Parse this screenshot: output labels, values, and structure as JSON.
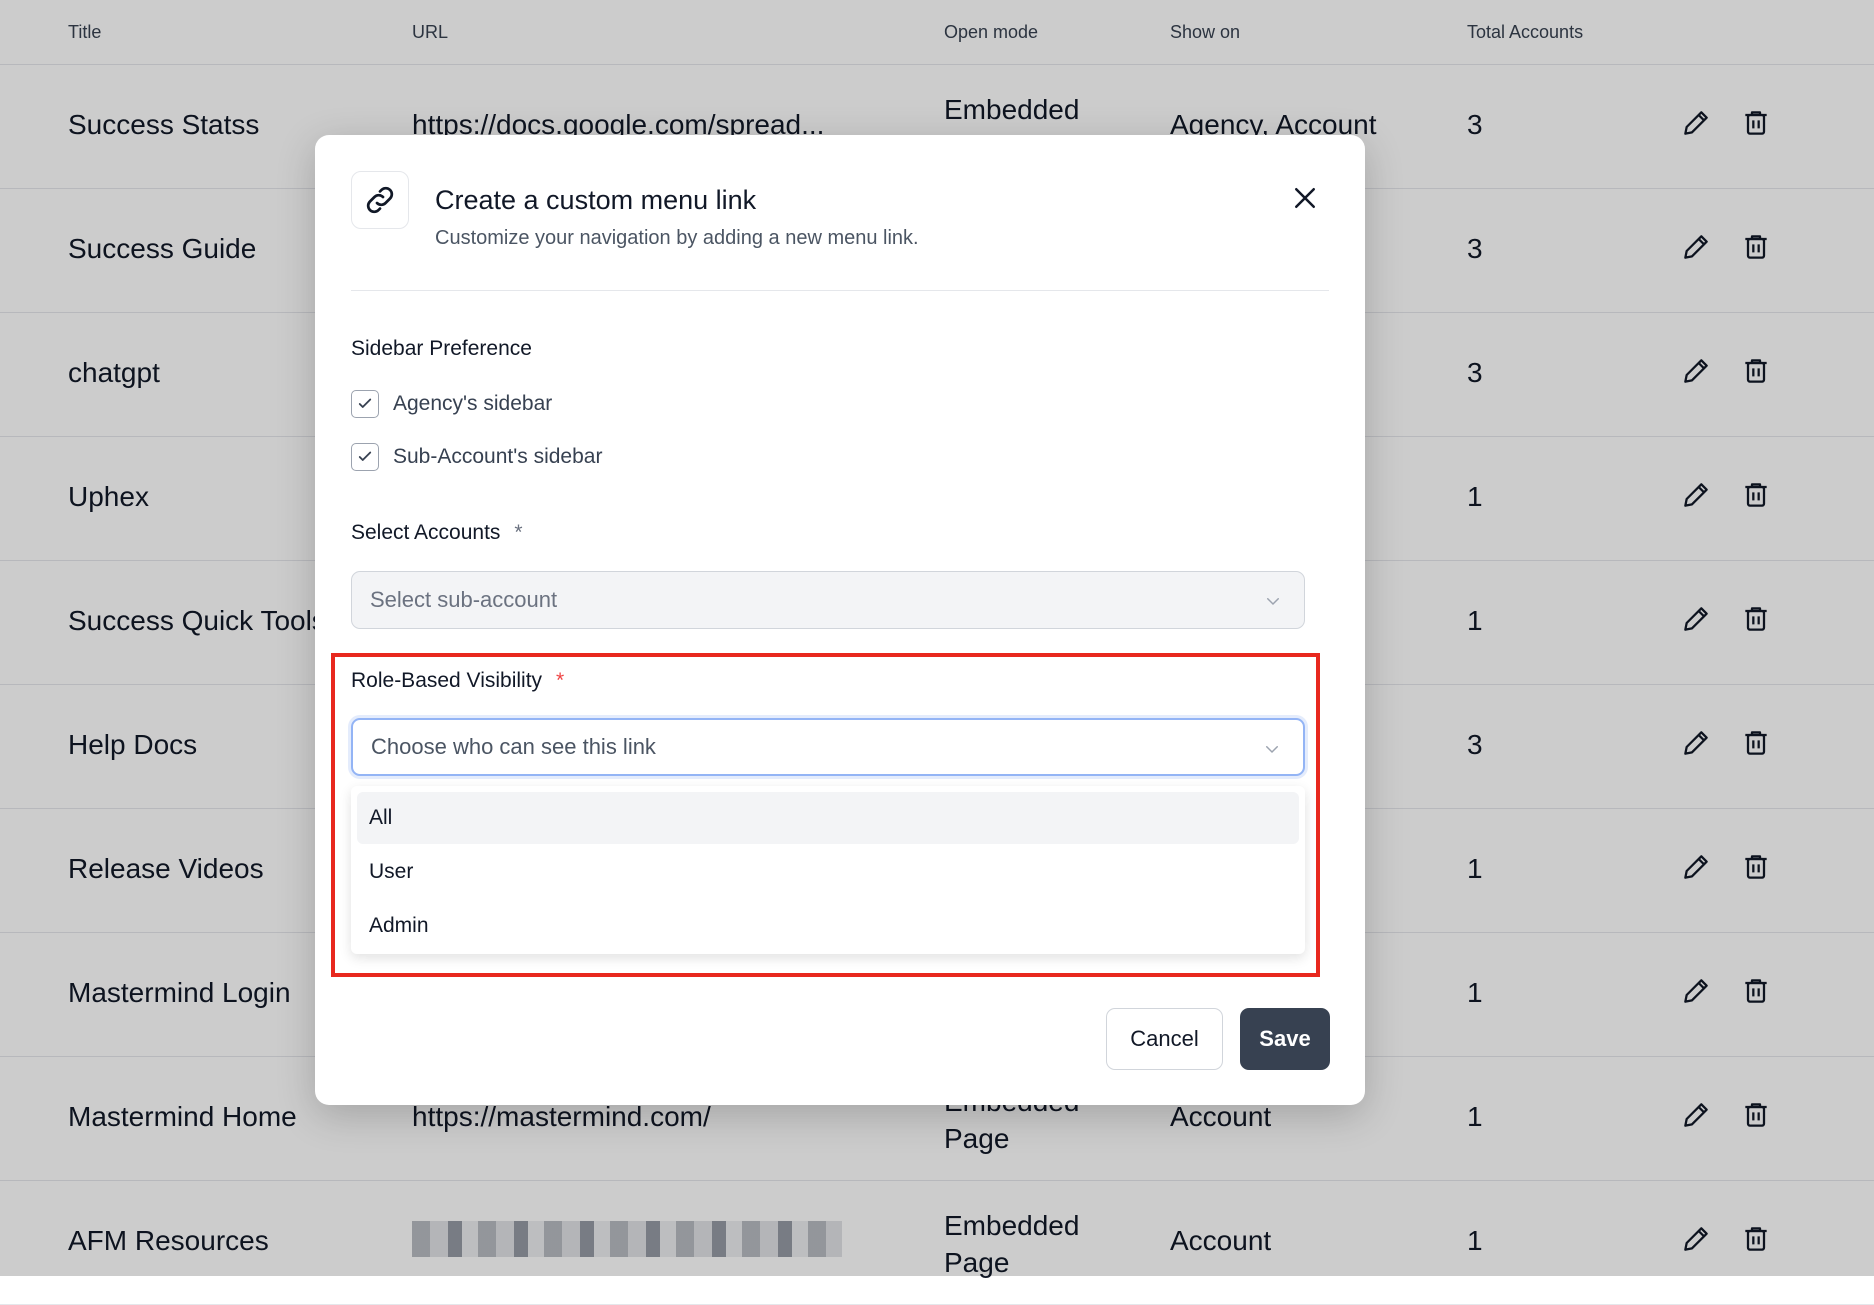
{
  "table": {
    "headers": [
      "Title",
      "URL",
      "Open mode",
      "Show on",
      "Total Accounts"
    ],
    "rows": [
      {
        "title": "Success Statss",
        "url": "https://docs.google.com/spread...",
        "mode": "Embedded Page",
        "show": "Agency, Account",
        "total": "3"
      },
      {
        "title": "Success Guide",
        "url": "",
        "mode": "",
        "show": "",
        "total": "3"
      },
      {
        "title": "chatgpt",
        "url": "",
        "mode": "",
        "show": "",
        "total": "3"
      },
      {
        "title": "Uphex",
        "url": "",
        "mode": "",
        "show": "",
        "total": "1"
      },
      {
        "title": "Success Quick Tools",
        "url": "",
        "mode": "",
        "show": "",
        "total": "1"
      },
      {
        "title": "Help Docs",
        "url": "",
        "mode": "",
        "show": "",
        "total": "3"
      },
      {
        "title": "Release Videos",
        "url": "",
        "mode": "",
        "show": "",
        "total": "1"
      },
      {
        "title": "Mastermind Login",
        "url": "",
        "mode": "",
        "show": "",
        "total": "1"
      },
      {
        "title": "Mastermind Home",
        "url": "https://mastermind.com/",
        "mode": "Embedded Page",
        "show": "Account",
        "total": "1"
      },
      {
        "title": "AFM Resources",
        "url": "",
        "mode": "Embedded Page",
        "show": "Account",
        "total": "1"
      }
    ]
  },
  "modal": {
    "title": "Create a custom menu link",
    "subtitle": "Customize your navigation by adding a new menu link.",
    "sidebar_pref_label": "Sidebar Preference",
    "agency_sidebar": "Agency's sidebar",
    "subaccount_sidebar": "Sub-Account's sidebar",
    "select_accounts_label": "Select Accounts",
    "required_mark": "*",
    "select_accounts_placeholder": "Select sub-account",
    "role_label": "Role-Based Visibility",
    "role_placeholder": "Choose who can see this link",
    "role_options": [
      "All",
      "User",
      "Admin"
    ],
    "cancel": "Cancel",
    "save": "Save"
  },
  "colors": {
    "highlight": "#e8281e",
    "save_bg": "#374151"
  }
}
